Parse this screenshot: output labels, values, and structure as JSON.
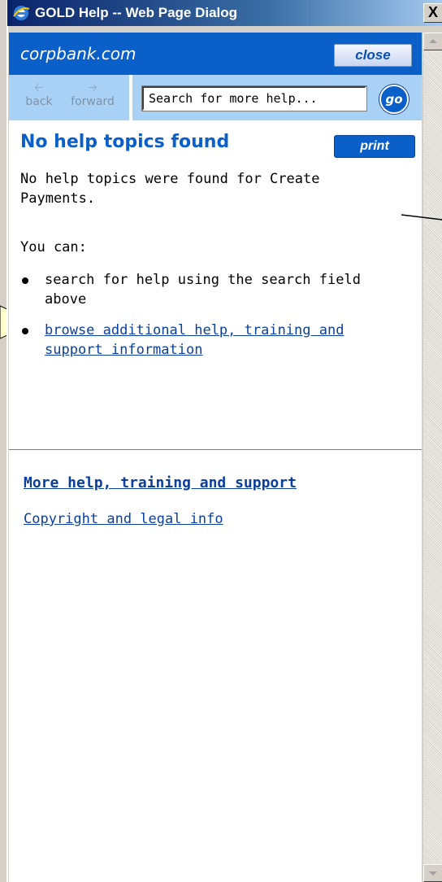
{
  "window": {
    "title": "GOLD Help -- Web Page Dialog",
    "close_glyph": "X"
  },
  "header": {
    "brand": "corpbank.com",
    "close_label": "close"
  },
  "nav": {
    "back_label": "back",
    "forward_label": "forward",
    "search_value": "Search for more help...",
    "go_label": "go"
  },
  "main": {
    "title": "No help topics found",
    "print_label": "print",
    "message": "No help topics were found for Create Payments.",
    "you_can": "You can:",
    "options": [
      {
        "text": "search for help using the search field above"
      },
      {
        "text": "browse additional help, training and support information"
      }
    ]
  },
  "footer": {
    "more_help_link": "More help, training and support",
    "copyright_link": "Copyright and legal info"
  },
  "colors": {
    "brand_blue": "#0b5fc9",
    "nav_light_blue": "#a9d0f5",
    "link": "#0b3f9f",
    "callout_fill": "#ffffcc"
  }
}
